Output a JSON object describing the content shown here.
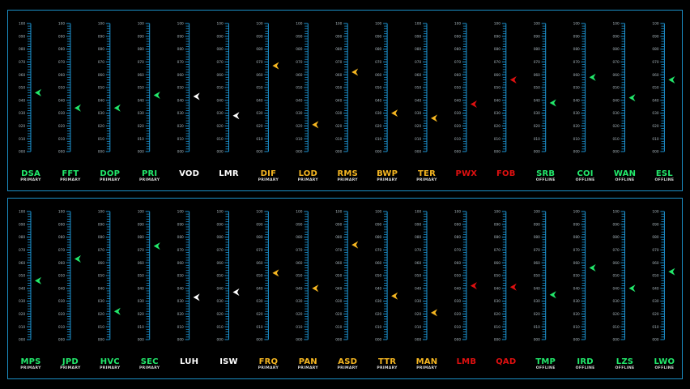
{
  "colors": {
    "frame": "#1c8fc7",
    "scale": "#1d95d4",
    "green": "#22e86b",
    "white": "#ffffff",
    "yellow": "#f5b621",
    "red": "#e01010"
  },
  "scale_ticks": [
    "100",
    "090",
    "080",
    "070",
    "060",
    "050",
    "040",
    "030",
    "020",
    "010",
    "000"
  ],
  "panels": [
    {
      "name": "top",
      "gauges": [
        {
          "code": "DSA",
          "status": "PRIMARY",
          "value": 46,
          "color": "green"
        },
        {
          "code": "FFT",
          "status": "PRIMARY",
          "value": 34,
          "color": "green"
        },
        {
          "code": "DOP",
          "status": "PRIMARY",
          "value": 34,
          "color": "green"
        },
        {
          "code": "PRI",
          "status": "PRIMARY",
          "value": 44,
          "color": "green"
        },
        {
          "code": "VOD",
          "status": "",
          "value": 43,
          "color": "white"
        },
        {
          "code": "LMR",
          "status": "",
          "value": 28,
          "color": "white"
        },
        {
          "code": "DIF",
          "status": "PRIMARY",
          "value": 67,
          "color": "yellow"
        },
        {
          "code": "LOD",
          "status": "PRIMARY",
          "value": 21,
          "color": "yellow"
        },
        {
          "code": "RMS",
          "status": "PRIMARY",
          "value": 62,
          "color": "yellow"
        },
        {
          "code": "BWP",
          "status": "PRIMARY",
          "value": 30,
          "color": "yellow"
        },
        {
          "code": "TER",
          "status": "PRIMARY",
          "value": 26,
          "color": "yellow"
        },
        {
          "code": "PWX",
          "status": "",
          "value": 37,
          "color": "red"
        },
        {
          "code": "FOB",
          "status": "",
          "value": 56,
          "color": "red"
        },
        {
          "code": "SRB",
          "status": "OFFLINE",
          "value": 38,
          "color": "green"
        },
        {
          "code": "COI",
          "status": "OFFLINE",
          "value": 58,
          "color": "green"
        },
        {
          "code": "WAN",
          "status": "OFFLINE",
          "value": 42,
          "color": "green"
        },
        {
          "code": "ESL",
          "status": "OFFLINE",
          "value": 56,
          "color": "green"
        }
      ]
    },
    {
      "name": "bottom",
      "gauges": [
        {
          "code": "MPS",
          "status": "PRIMARY",
          "value": 46,
          "color": "green"
        },
        {
          "code": "JPD",
          "status": "PRIMARY",
          "value": 63,
          "color": "green"
        },
        {
          "code": "HVC",
          "status": "PRIMARY",
          "value": 22,
          "color": "green"
        },
        {
          "code": "SEC",
          "status": "PRIMARY",
          "value": 73,
          "color": "green"
        },
        {
          "code": "LUH",
          "status": "",
          "value": 33,
          "color": "white"
        },
        {
          "code": "ISW",
          "status": "",
          "value": 37,
          "color": "white"
        },
        {
          "code": "FRQ",
          "status": "PRIMARY",
          "value": 52,
          "color": "yellow"
        },
        {
          "code": "PAN",
          "status": "PRIMARY",
          "value": 40,
          "color": "yellow"
        },
        {
          "code": "ASD",
          "status": "PRIMARY",
          "value": 74,
          "color": "yellow"
        },
        {
          "code": "TTR",
          "status": "PRIMARY",
          "value": 34,
          "color": "yellow"
        },
        {
          "code": "MAN",
          "status": "PRIMARY",
          "value": 21,
          "color": "yellow"
        },
        {
          "code": "LMB",
          "status": "",
          "value": 42,
          "color": "red"
        },
        {
          "code": "QAD",
          "status": "",
          "value": 41,
          "color": "red"
        },
        {
          "code": "TMP",
          "status": "OFFLINE",
          "value": 35,
          "color": "green"
        },
        {
          "code": "IRD",
          "status": "OFFLINE",
          "value": 56,
          "color": "green"
        },
        {
          "code": "LZS",
          "status": "OFFLINE",
          "value": 40,
          "color": "green"
        },
        {
          "code": "LWO",
          "status": "OFFLINE",
          "value": 53,
          "color": "green"
        }
      ]
    }
  ]
}
